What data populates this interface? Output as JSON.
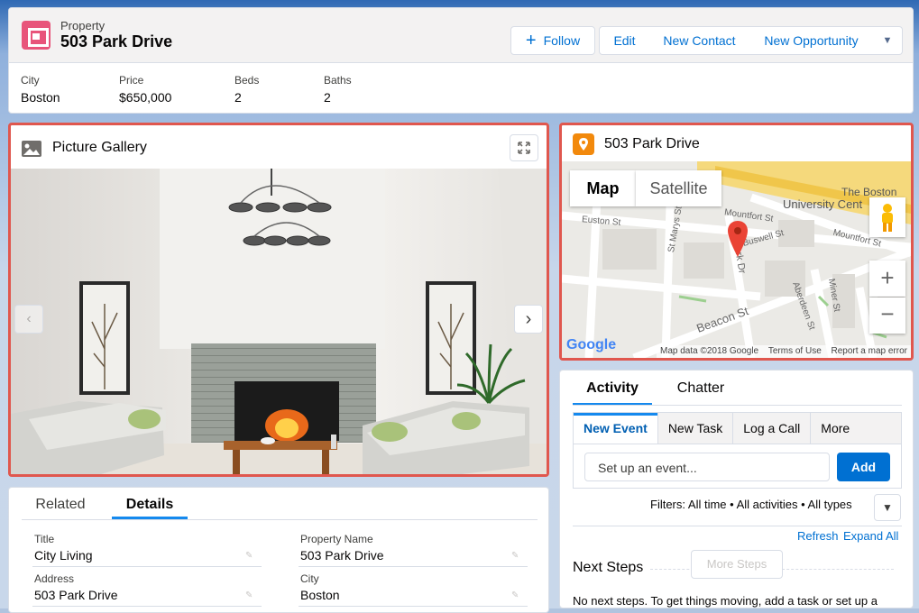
{
  "record": {
    "object_type": "Property",
    "name": "503 Park Drive",
    "actions": {
      "follow": "Follow",
      "edit": "Edit",
      "new_contact": "New Contact",
      "new_opportunity": "New Opportunity"
    },
    "highlights": [
      {
        "label": "City",
        "value": "Boston"
      },
      {
        "label": "Price",
        "value": "$650,000"
      },
      {
        "label": "Beds",
        "value": "2"
      },
      {
        "label": "Baths",
        "value": "2"
      }
    ]
  },
  "gallery": {
    "title": "Picture Gallery"
  },
  "map": {
    "title": "503 Park Drive",
    "tab_map": "Map",
    "tab_satellite": "Satellite",
    "labels": {
      "boston": "The Boston",
      "university": "University Cent",
      "mountfort1": "Mountfort St",
      "mountfort2": "Mountfort St",
      "euston": "Euston St",
      "stmarys": "St Marys St",
      "buswell": "Buswell St",
      "parkdr": "Park Dr",
      "beacon": "Beacon St",
      "miner": "Miner St",
      "aberdeen": "Aberdeen St"
    },
    "footer": {
      "google": "Google",
      "mapdata": "Map data ©2018 Google",
      "terms": "Terms of Use",
      "report": "Report a map error"
    }
  },
  "activity": {
    "tabs": [
      "Activity",
      "Chatter"
    ],
    "subtabs": [
      "New Event",
      "New Task",
      "Log a Call",
      "More"
    ],
    "event_placeholder": "Set up an event...",
    "add": "Add",
    "filters": "Filters: All time • All activities • All types",
    "refresh": "Refresh",
    "expand": "Expand All",
    "next_steps": "Next Steps",
    "more_steps": "More Steps",
    "no_steps": "No next steps. To get things moving, add a task or set up a"
  },
  "details": {
    "tabs": [
      "Related",
      "Details"
    ],
    "fields": [
      {
        "label": "Title",
        "value": "City Living"
      },
      {
        "label": "Property Name",
        "value": "503 Park Drive"
      },
      {
        "label": "Address",
        "value": "503 Park Drive"
      },
      {
        "label": "City",
        "value": "Boston"
      }
    ]
  }
}
